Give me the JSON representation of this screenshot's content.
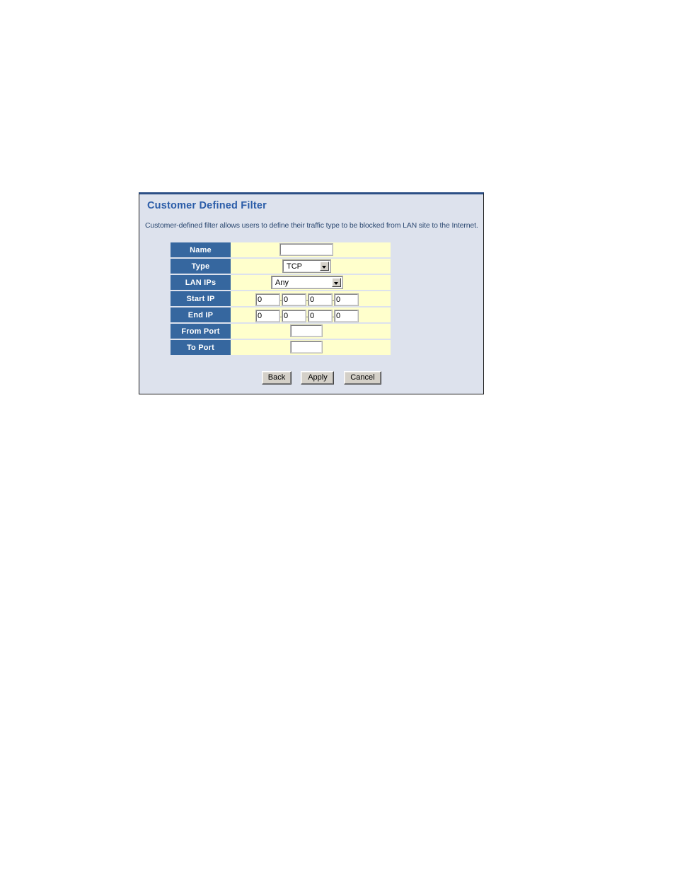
{
  "panel": {
    "title": "Customer Defined Filter",
    "description": "Customer-defined filter allows users to define their traffic type to be blocked from LAN site to the Internet."
  },
  "form": {
    "rows": [
      {
        "label": "Name",
        "kind": "text",
        "value": ""
      },
      {
        "label": "Type",
        "kind": "select",
        "value": "TCP"
      },
      {
        "label": "LAN IPs",
        "kind": "select",
        "value": "Any"
      },
      {
        "label": "Start IP",
        "kind": "ip",
        "octets": [
          "0",
          "0",
          "0",
          "0"
        ]
      },
      {
        "label": "End IP",
        "kind": "ip",
        "octets": [
          "0",
          "0",
          "0",
          "0"
        ]
      },
      {
        "label": "From Port",
        "kind": "text",
        "value": ""
      },
      {
        "label": "To Port",
        "kind": "text",
        "value": ""
      }
    ],
    "ip_separator": "."
  },
  "buttons": {
    "back": "Back",
    "apply": "Apply",
    "cancel": "Cancel"
  },
  "colors": {
    "panel_background": "#dde2ed",
    "panel_top_border": "#2c4f86",
    "title_text": "#2a5ca8",
    "description_text": "#2d4a72",
    "label_cell": "#36679f",
    "label_text": "#ffffff",
    "field_cell": "#ffffcc",
    "button_face": "#d4d0c8"
  }
}
